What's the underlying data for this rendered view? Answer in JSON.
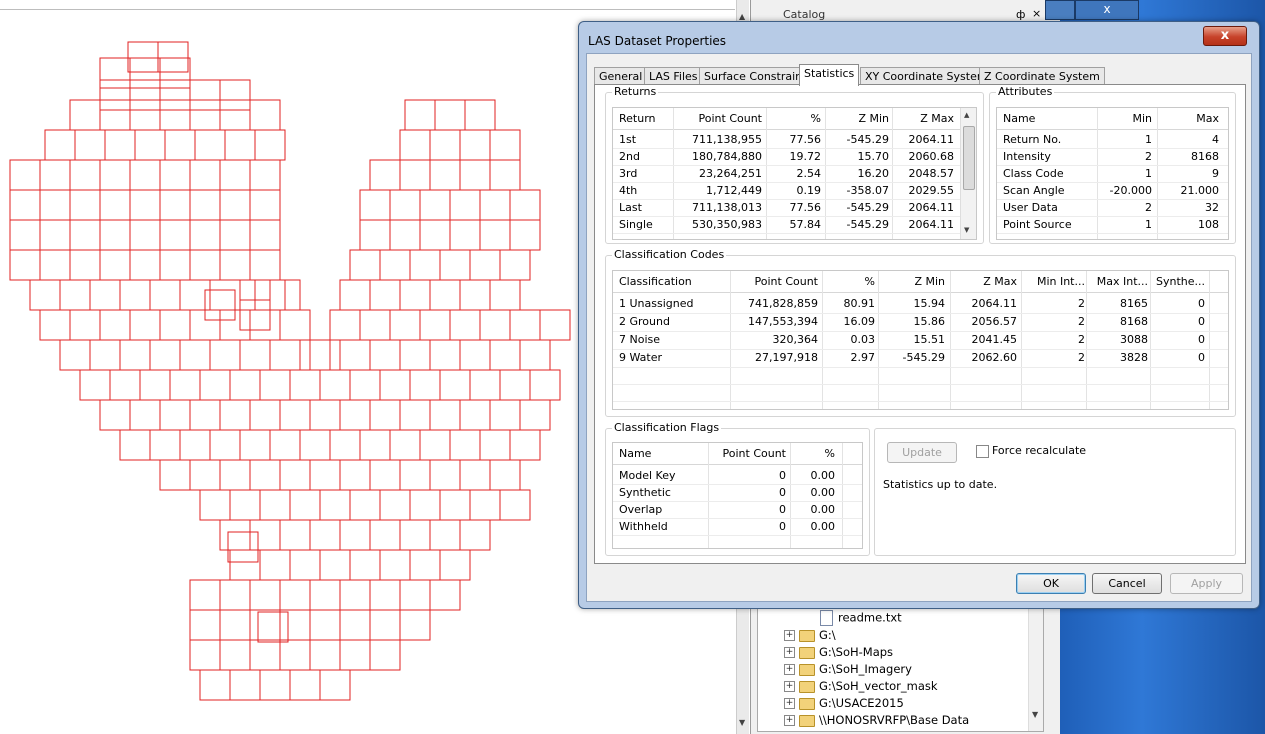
{
  "map": {
    "stroke": "#e02020"
  },
  "catalog": {
    "title": "Catalog",
    "pin": "ф",
    "close": "×",
    "tree": [
      {
        "type": "file",
        "label": "readme.txt"
      },
      {
        "type": "folder",
        "label": "G:\\"
      },
      {
        "type": "folder",
        "label": "G:\\SoH-Maps"
      },
      {
        "type": "folder",
        "label": "G:\\SoH_Imagery"
      },
      {
        "type": "folder",
        "label": "G:\\SoH_vector_mask"
      },
      {
        "type": "folder",
        "label": "G:\\USACE2015"
      },
      {
        "type": "folder",
        "label": "\\\\HONOSRVRFP\\Base Data"
      }
    ]
  },
  "dialog": {
    "title": "LAS Dataset Properties",
    "close_label": "x",
    "tabs": [
      "General",
      "LAS Files",
      "Surface Constraints",
      "Statistics",
      "XY Coordinate System",
      "Z Coordinate System"
    ],
    "active_tab": "Statistics",
    "returns": {
      "label": "Returns",
      "columns": [
        "Return",
        "Point Count",
        "%",
        "Z Min",
        "Z Max"
      ],
      "rows": [
        [
          "1st",
          "711,138,955",
          "77.56",
          "-545.29",
          "2064.11"
        ],
        [
          "2nd",
          "180,784,880",
          "19.72",
          "15.70",
          "2060.68"
        ],
        [
          "3rd",
          "23,264,251",
          "2.54",
          "16.20",
          "2048.57"
        ],
        [
          "4th",
          "1,712,449",
          "0.19",
          "-358.07",
          "2029.55"
        ],
        [
          "Last",
          "711,138,013",
          "77.56",
          "-545.29",
          "2064.11"
        ],
        [
          "Single",
          "530,350,983",
          "57.84",
          "-545.29",
          "2064.11"
        ]
      ]
    },
    "attributes": {
      "label": "Attributes",
      "columns": [
        "Name",
        "Min",
        "Max"
      ],
      "rows": [
        [
          "Return No.",
          "1",
          "4"
        ],
        [
          "Intensity",
          "2",
          "8168"
        ],
        [
          "Class Code",
          "1",
          "9"
        ],
        [
          "Scan Angle",
          "-20.000",
          "21.000"
        ],
        [
          "User Data",
          "2",
          "32"
        ],
        [
          "Point Source",
          "1",
          "108"
        ]
      ]
    },
    "classification_codes": {
      "label": "Classification Codes",
      "columns": [
        "Classification",
        "Point Count",
        "%",
        "Z Min",
        "Z Max",
        "Min Int...",
        "Max Int...",
        "Synthe..."
      ],
      "rows": [
        [
          "1 Unassigned",
          "741,828,859",
          "80.91",
          "15.94",
          "2064.11",
          "2",
          "8165",
          "0"
        ],
        [
          "2 Ground",
          "147,553,394",
          "16.09",
          "15.86",
          "2056.57",
          "2",
          "8168",
          "0"
        ],
        [
          "7 Noise",
          "320,364",
          "0.03",
          "15.51",
          "2041.45",
          "2",
          "3088",
          "0"
        ],
        [
          "9 Water",
          "27,197,918",
          "2.97",
          "-545.29",
          "2062.60",
          "2",
          "3828",
          "0"
        ]
      ]
    },
    "classification_flags": {
      "label": "Classification Flags",
      "columns": [
        "Name",
        "Point Count",
        "%"
      ],
      "rows": [
        [
          "Model Key",
          "0",
          "0.00"
        ],
        [
          "Synthetic",
          "0",
          "0.00"
        ],
        [
          "Overlap",
          "0",
          "0.00"
        ],
        [
          "Withheld",
          "0",
          "0.00"
        ]
      ]
    },
    "update": {
      "button": "Update",
      "force_label": "Force recalculate",
      "status": "Statistics up to date."
    },
    "buttons": {
      "ok": "OK",
      "cancel": "Cancel",
      "apply": "Apply"
    }
  }
}
